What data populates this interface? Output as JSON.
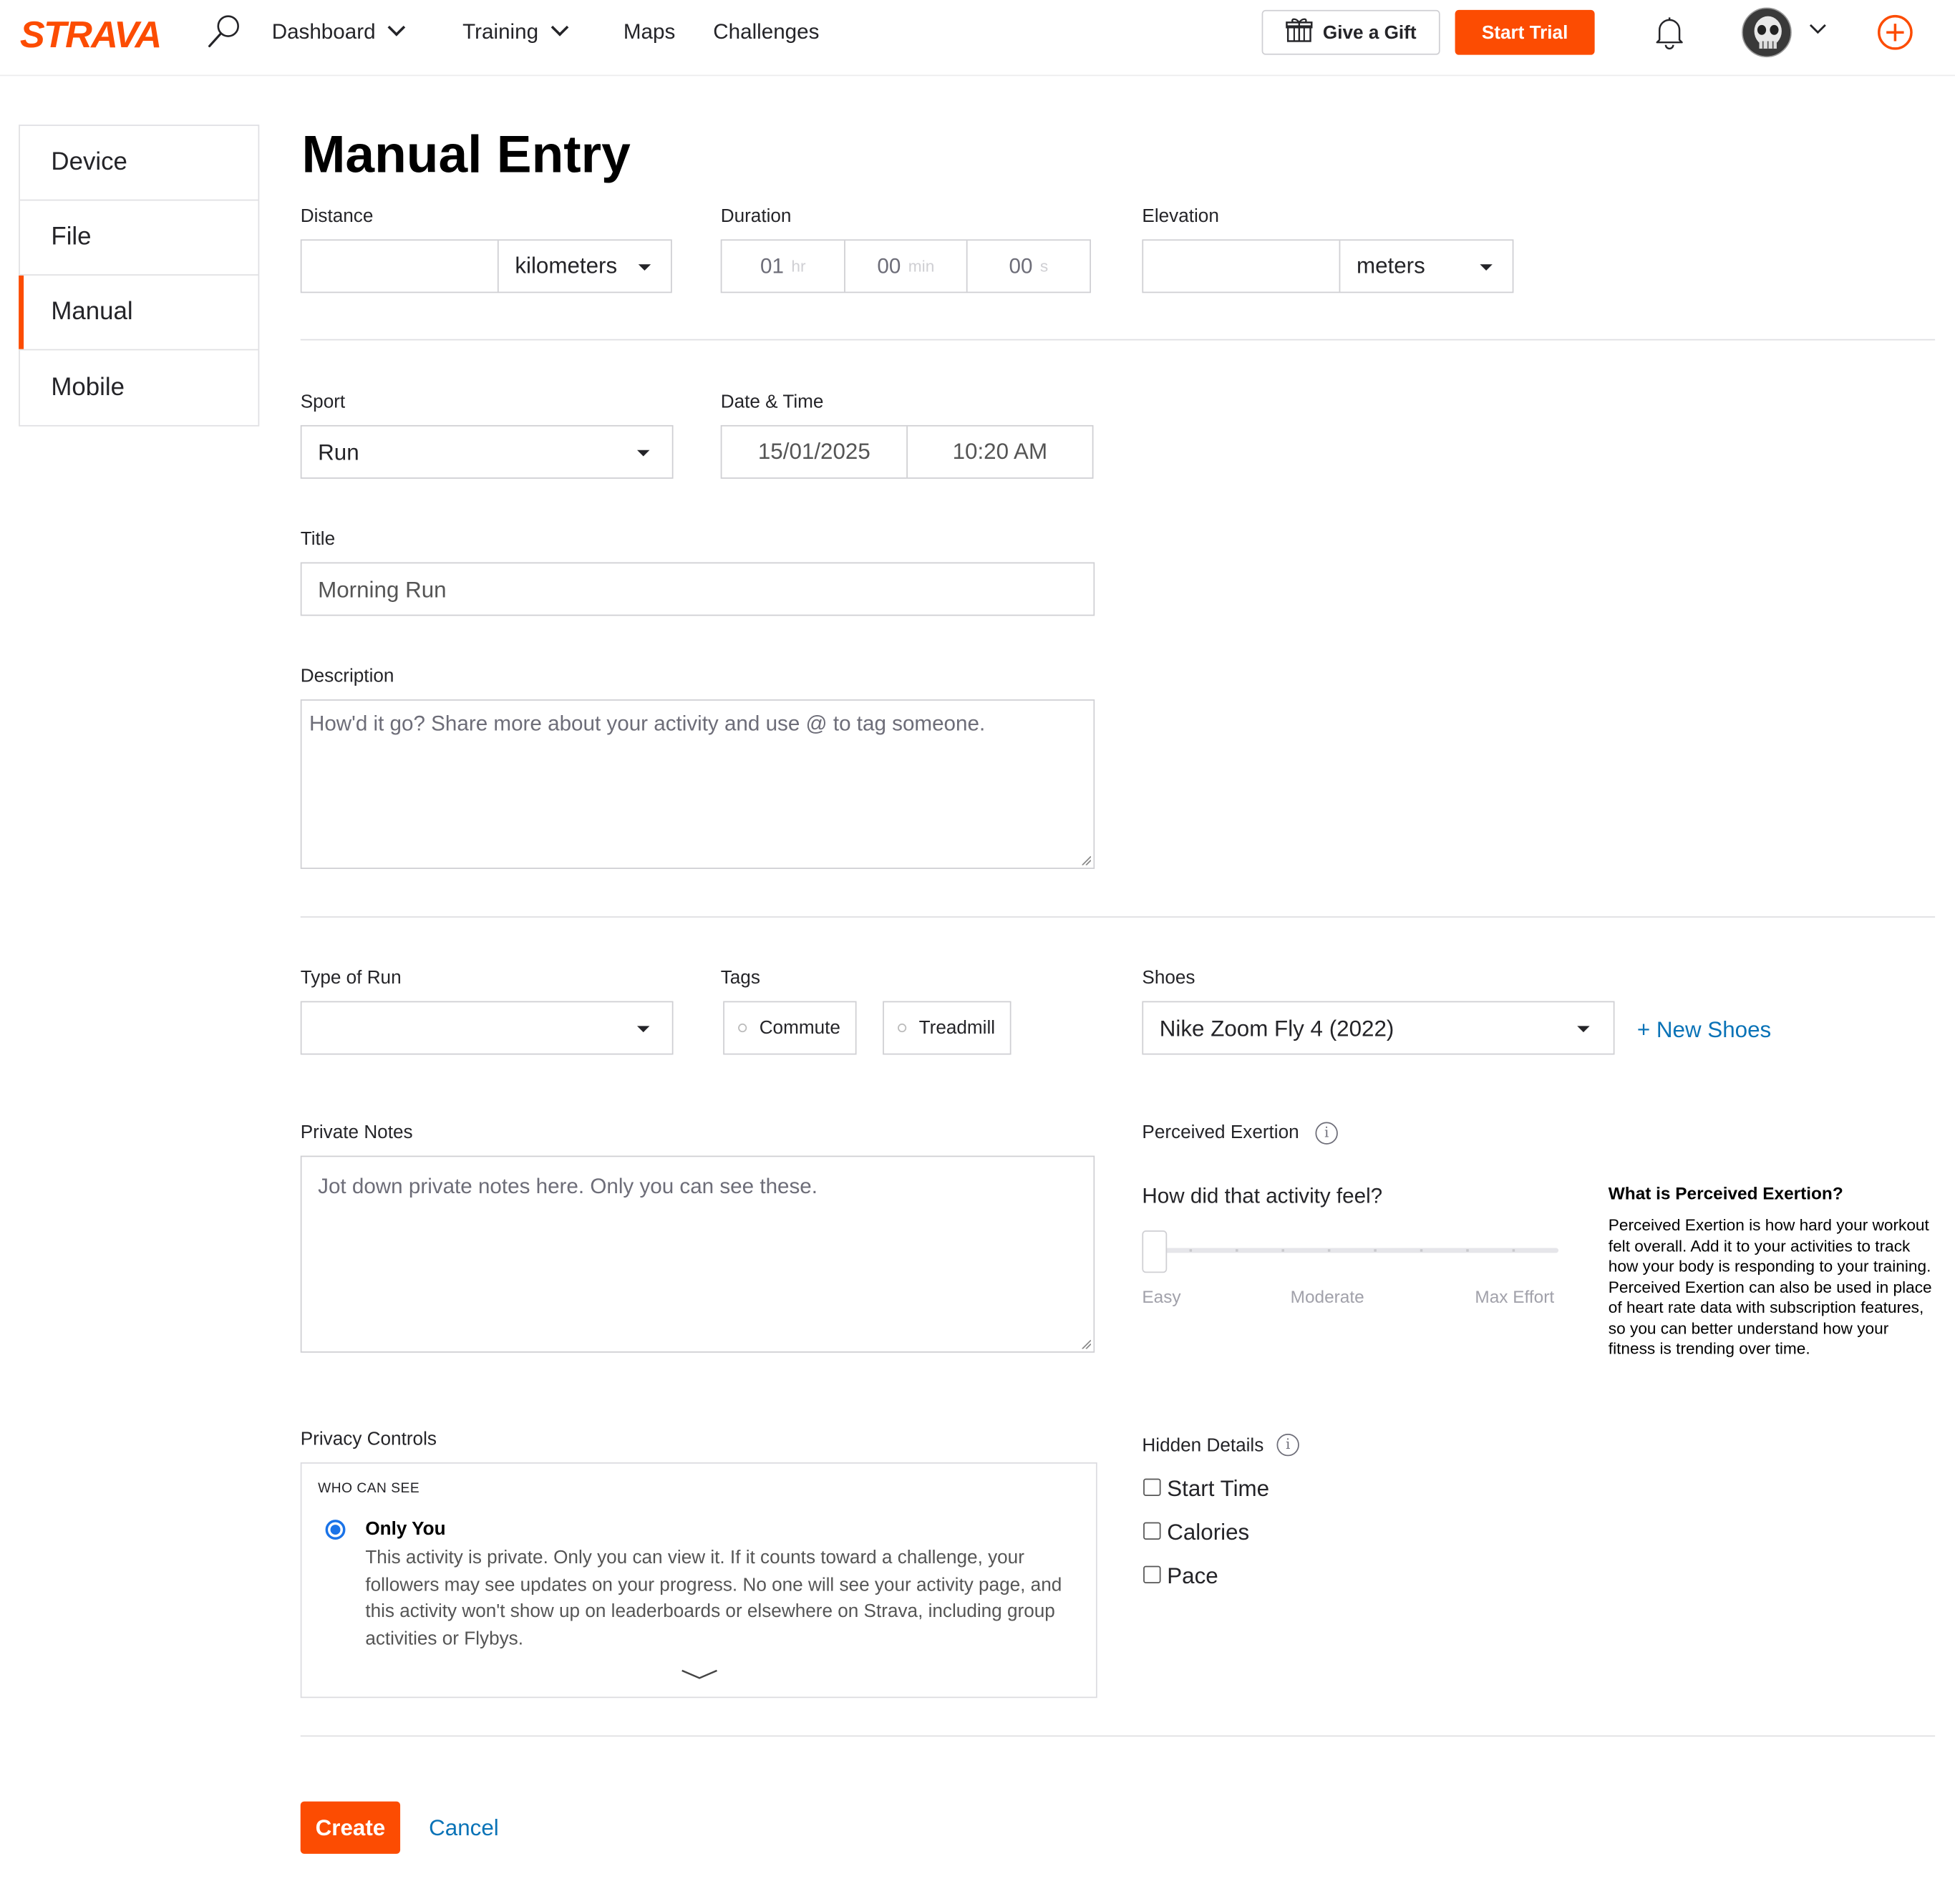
{
  "colors": {
    "brand": "#fc4c02",
    "link": "#0a73b7",
    "radio": "#1a73e8"
  },
  "header": {
    "logo": "STRAVA",
    "nav": [
      {
        "label": "Dashboard",
        "has_dropdown": true
      },
      {
        "label": "Training",
        "has_dropdown": true
      },
      {
        "label": "Maps",
        "has_dropdown": false
      },
      {
        "label": "Challenges",
        "has_dropdown": false
      }
    ],
    "give_gift": "Give a Gift",
    "start_trial": "Start Trial",
    "icons": [
      "search-icon",
      "gift-icon",
      "bell-icon",
      "avatar",
      "chevron-down-icon",
      "plus-circle-icon"
    ]
  },
  "sidebar": {
    "items": [
      {
        "label": "Device",
        "active": false
      },
      {
        "label": "File",
        "active": false
      },
      {
        "label": "Manual",
        "active": true
      },
      {
        "label": "Mobile",
        "active": false
      }
    ]
  },
  "page": {
    "title": "Manual Entry"
  },
  "form": {
    "distance": {
      "label": "Distance",
      "value": "",
      "unit": "kilometers"
    },
    "duration": {
      "label": "Duration",
      "hours": "01",
      "hours_unit": "hr",
      "minutes": "00",
      "minutes_unit": "min",
      "seconds": "00",
      "seconds_unit": "s"
    },
    "elevation": {
      "label": "Elevation",
      "value": "",
      "unit": "meters"
    },
    "sport": {
      "label": "Sport",
      "value": "Run"
    },
    "datetime": {
      "label": "Date & Time",
      "date": "15/01/2025",
      "time": "10:20 AM"
    },
    "title": {
      "label": "Title",
      "value": "Morning Run"
    },
    "description": {
      "label": "Description",
      "placeholder": "How'd it go? Share more about your activity and use @ to tag someone."
    },
    "type_of_run": {
      "label": "Type of Run",
      "value": ""
    },
    "tags": {
      "label": "Tags",
      "items": [
        "Commute",
        "Treadmill"
      ]
    },
    "shoes": {
      "label": "Shoes",
      "value": "Nike Zoom Fly 4 (2022)",
      "new_shoes": "+ New Shoes"
    },
    "private_notes": {
      "label": "Private Notes",
      "placeholder": "Jot down private notes here. Only you can see these."
    },
    "perceived_exertion": {
      "label": "Perceived Exertion",
      "question": "How did that activity feel?",
      "value": 0,
      "scale": [
        "Easy",
        "Moderate",
        "Max Effort"
      ],
      "info_title": "What is Perceived Exertion?",
      "info_body": "Perceived Exertion is how hard your workout felt overall. Add it to your activities to track how your body is responding to your training. Perceived Exertion can also be used in place of heart rate data with subscription features, so you can better understand how your fitness is trending over time."
    },
    "privacy": {
      "label": "Privacy Controls",
      "who_can_see": "WHO CAN SEE",
      "option": "Only You",
      "option_desc": "This activity is private. Only you can view it. If it counts toward a challenge, your followers may see updates on your progress. No one will see your activity page, and this activity won't show up on leaderboards or elsewhere on Strava, including group activities or Flybys."
    },
    "hidden_details": {
      "label": "Hidden Details",
      "items": [
        {
          "label": "Start Time",
          "checked": false
        },
        {
          "label": "Calories",
          "checked": false
        },
        {
          "label": "Pace",
          "checked": false
        }
      ]
    },
    "create": "Create",
    "cancel": "Cancel"
  }
}
